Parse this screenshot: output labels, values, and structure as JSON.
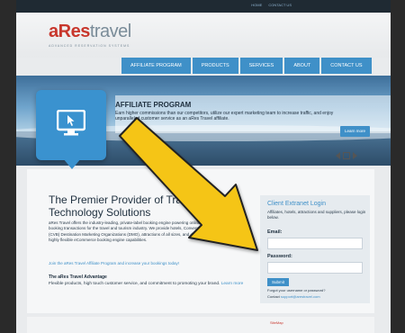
{
  "header": {
    "logo_brand": "aRes",
    "logo_rest": "travel",
    "tagline": "ADVANCED RESERVATION SYSTEMS",
    "top_links": [
      "HOME",
      "CONTACT US"
    ]
  },
  "nav": {
    "items": [
      {
        "label": "AFFILIATE PROGRAM"
      },
      {
        "label": "PRODUCTS"
      },
      {
        "label": "SERVICES"
      },
      {
        "label": "ABOUT"
      },
      {
        "label": "CONTACT US"
      }
    ]
  },
  "hero": {
    "title": "AFFILIATE PROGRAM",
    "text": "Earn higher commissions than our competitors, utilize our expert marketing team to increase traffic, and enjoy unparalleled customer service as an aRes Travel affiliate.",
    "learn_more": "Learn more",
    "icon": "monitor-cursor-icon"
  },
  "main": {
    "title": "The Premier Provider of Travel and Technology Solutions",
    "body": "aRes Travel offers the industry-leading, private-label booking engine powering online reservations and booking transactions for the travel and tourism industry. We provide hotels, Convention & Visitors Bureaus (CVB) Destination Marketing Organizations (DMO), attractions of all sizes, and destination websites with a highly flexible eCommerce booking engine capabilities.",
    "join_link": "Join the aRes Travel Affiliate Program and increase your bookings today!",
    "advantage_title": "The aRes Travel Advantage",
    "advantage_text": "Flexible products, high touch customer service, and commitment to promoting your brand.",
    "advantage_link": "Learn more"
  },
  "login": {
    "title": "Client Extranet Login",
    "desc": "Affiliates, hotels, attractions and suppliers, please login below.",
    "email_label": "Email:",
    "password_label": "Password:",
    "submit": "Submit",
    "forgot": "Forgot your username or password?",
    "contact_prefix": "Contact",
    "contact_email": "support@arestravel.com"
  },
  "footer": {
    "link": "SiteMap"
  },
  "colors": {
    "accent": "#3f90c8",
    "brand": "#c8372d",
    "arrow": "#f5c518"
  }
}
